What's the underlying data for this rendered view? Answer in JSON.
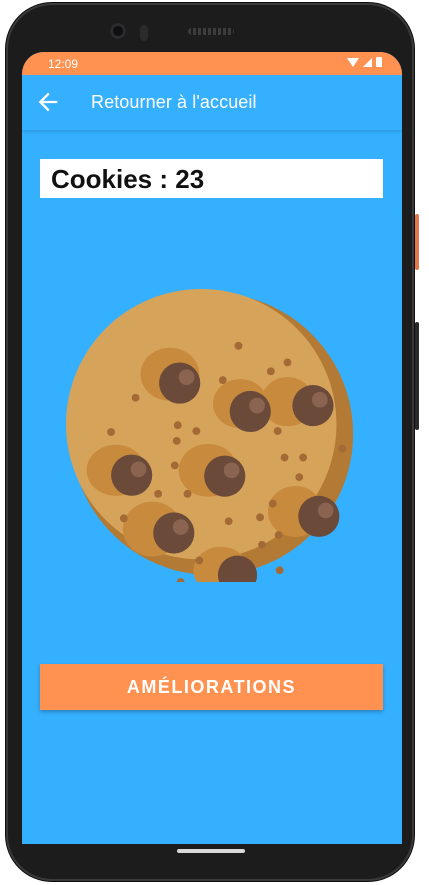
{
  "status_bar": {
    "time": "12:09",
    "icons": [
      "wifi-icon",
      "signal-icon",
      "battery-icon"
    ],
    "color": "#ff9151"
  },
  "app_bar": {
    "back_icon": "arrow-back-icon",
    "title": "Retourner à l'accueil",
    "color": "#35b0ff"
  },
  "counter": {
    "label": "Cookies : ",
    "value": "23"
  },
  "cookie": {
    "icon": "cookie-icon",
    "dough_color": "#d6a35a",
    "shadow_color": "#b27a34",
    "chip_color": "#6b4a3a"
  },
  "upgrades_button": {
    "label": "AMÉLIORATIONS",
    "color": "#ff9151"
  },
  "theme": {
    "background": "#35b0ff",
    "accent": "#ff9151"
  }
}
